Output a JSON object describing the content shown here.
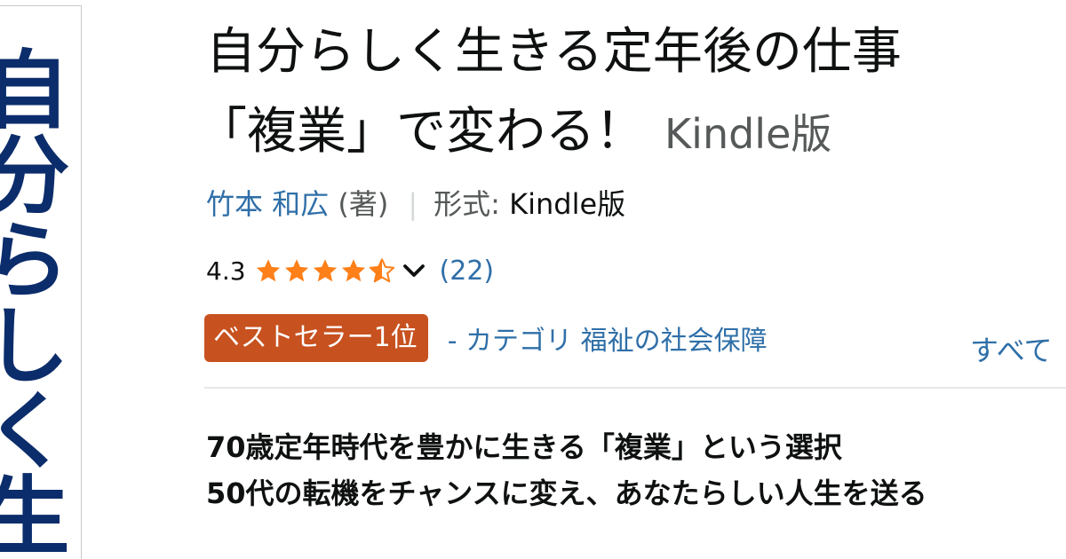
{
  "cover": {
    "text": "自分らしく生"
  },
  "product": {
    "title_line1": "自分らしく生きる定年後の仕事",
    "title_line2": "「複業」で変わる！",
    "binding": "Kindle版",
    "author": "竹本 和広",
    "author_role": "(著)",
    "separator": "|",
    "format_label": "形式:",
    "format_value": "Kindle版"
  },
  "rating": {
    "value": "4.3",
    "stars_out_of_5": 4.3,
    "review_count": "(22)"
  },
  "bestseller": {
    "badge": "ベストセラー1位",
    "category": "- カテゴリ 福祉の社会保障",
    "see_all": "すべて"
  },
  "description": {
    "line1": "70歳定年時代を豊かに生きる「複業」という選択",
    "line2": "50代の転機をチャンスに変え、あなたらしい人生を送る"
  },
  "colors": {
    "link": "#2f6fa8",
    "star": "#ff7f18",
    "badge_bg": "#c7511f",
    "cover_text": "#0c2d6b"
  },
  "icons": {
    "star": "star-icon",
    "half_star": "half-star-icon",
    "chevron": "chevron-down-icon"
  }
}
